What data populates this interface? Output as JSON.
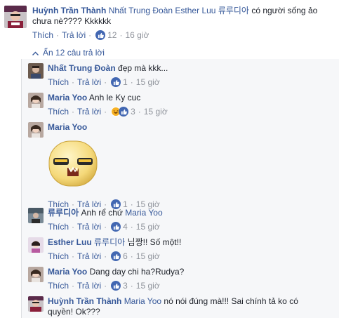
{
  "top_comment": {
    "author": "Huỳnh Trần Thành",
    "tags": [
      "Nhất Trung Đoàn",
      "Esther Luu",
      "류루디아"
    ],
    "text_line1": "có người sống ảo",
    "text_line2": "chưa nè???? Kkkkkk",
    "like_label": "Thích",
    "reply_label": "Trả lời",
    "reaction_count": "12",
    "time": "16 giờ"
  },
  "hide_replies_label": "Ẩn 12 câu trả lời",
  "replies": [
    {
      "author": "Nhất Trung Đoàn",
      "tag": "",
      "text": "đẹp mà kkk...",
      "like_label": "Thích",
      "reply_label": "Trả lời",
      "reaction_count": "1",
      "time": "15 giờ"
    },
    {
      "author": "Maria Yoo",
      "tag": "",
      "text": "Anh le Ky cuc",
      "like_label": "Thích",
      "reply_label": "Trả lời",
      "reaction_count": "3",
      "time": "15 giờ"
    },
    {
      "author": "Maria Yoo",
      "tag": "",
      "text": "",
      "like_label": "Thích",
      "reply_label": "Trả lời",
      "reaction_count": "1",
      "time": "15 giờ"
    },
    {
      "author": "류루디아",
      "tag": "Maria Yoo",
      "text": "Anh rể chứ",
      "like_label": "Thích",
      "reply_label": "Trả lời",
      "reaction_count": "4",
      "time": "15 giờ"
    },
    {
      "author": "Esther Luu",
      "tag": "류루디아",
      "text": "님짱!! Số một!!",
      "like_label": "Thích",
      "reply_label": "Trả lời",
      "reaction_count": "6",
      "time": "15 giờ"
    },
    {
      "author": "Maria Yoo",
      "tag": "",
      "text": "Dang day chi ha?Rudya?",
      "like_label": "Thích",
      "reply_label": "Trả lời",
      "reaction_count": "3",
      "time": "15 giờ"
    },
    {
      "author": "Huỳnh Trần Thành",
      "tag": "Maria Yoo",
      "text_line1": "nó nói đúng mà!!! Sai chính tả ko có",
      "text_line2": "quyền! Ok???"
    }
  ],
  "colors": {
    "link": "#365899",
    "meta": "#90949c",
    "like_blue": "#4267b2",
    "haha_yellow": "#f7b125",
    "reply_bg": "#f6f7f9"
  },
  "icons": [
    "like-icon",
    "haha-icon",
    "chevron-up-icon",
    "sticker-icon"
  ]
}
